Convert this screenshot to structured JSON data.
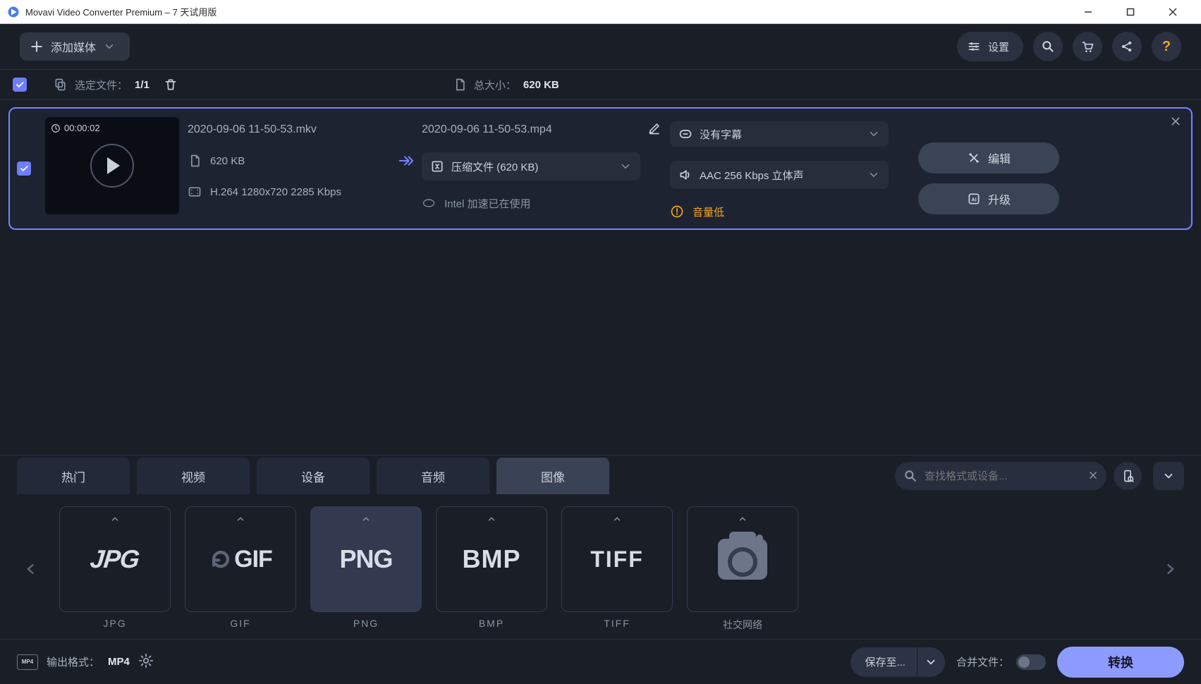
{
  "window": {
    "title": "Movavi Video Converter Premium – 7 天试用版"
  },
  "toolbar": {
    "add_media": "添加媒体",
    "settings": "设置"
  },
  "second_bar": {
    "selected_label": "选定文件：",
    "selected_value": "1/1",
    "total_label": "总大小：",
    "total_value": "620 KB"
  },
  "file": {
    "duration": "00:00:02",
    "source_name": "2020-09-06 11-50-53.mkv",
    "source_size": "620 KB",
    "source_codec": "H.264 1280x720 2285 Kbps",
    "target_name": "2020-09-06 11-50-53.mp4",
    "compress_label": "压缩文件 (620 KB)",
    "accel_label": "Intel 加速已在使用",
    "subtitle_label": "没有字幕",
    "audio_label": "AAC 256 Kbps 立体声",
    "warning_label": "音量低",
    "edit_label": "编辑",
    "upgrade_label": "升级"
  },
  "tabs": {
    "items": [
      "热门",
      "视频",
      "设备",
      "音频",
      "图像"
    ],
    "active_index": 4,
    "search_placeholder": "查找格式或设备..."
  },
  "formats": {
    "items": [
      {
        "big": "JPG",
        "caption": "JPG",
        "type": "text",
        "italic": true
      },
      {
        "big": "GIF",
        "caption": "GIF",
        "type": "gif"
      },
      {
        "big": "PNG",
        "caption": "PNG",
        "type": "text",
        "selected": true
      },
      {
        "big": "BMP",
        "caption": "BMP",
        "type": "text"
      },
      {
        "big": "TIFF",
        "caption": "TIFF",
        "type": "text"
      },
      {
        "big": "",
        "caption": "社交网络",
        "type": "camera"
      }
    ]
  },
  "bottom": {
    "out_label": "输出格式：",
    "out_value": "MP4",
    "save_to": "保存至...",
    "merge": "合并文件：",
    "convert": "转换"
  }
}
